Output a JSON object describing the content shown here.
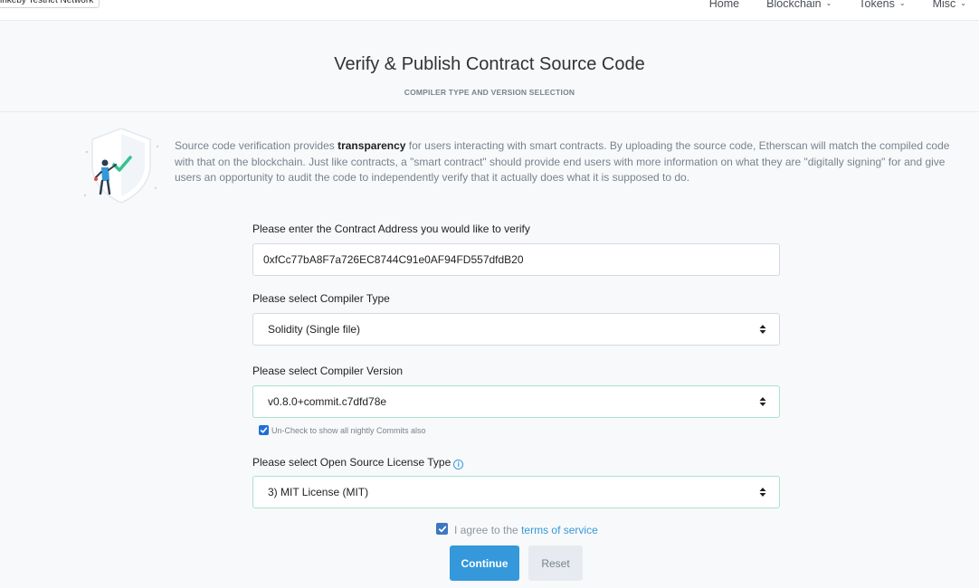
{
  "network_badge": "inkeby Testnet Network",
  "nav": {
    "home": "Home",
    "blockchain": "Blockchain",
    "tokens": "Tokens",
    "misc": "Misc"
  },
  "header": {
    "title": "Verify & Publish Contract Source Code",
    "subtitle": "COMPILER TYPE AND VERSION SELECTION"
  },
  "intro": {
    "part1": "Source code verification provides ",
    "bold": "transparency",
    "part2": " for users interacting with smart contracts. By uploading the source code, Etherscan will match the compiled code with that on the blockchain. Just like contracts, a \"smart contract\" should provide end users with more information on what they are \"digitally signing\" for and give users an opportunity to audit the code to independently verify that it actually does what it is supposed to do."
  },
  "form": {
    "address_label": "Please enter the Contract Address you would like to verify",
    "address_value": "0xfCc77bA8F7a726EC8744C91e0AF94FD557dfdB20",
    "compiler_type_label": "Please select Compiler Type",
    "compiler_type_value": "Solidity (Single file)",
    "compiler_version_label": "Please select Compiler Version",
    "compiler_version_value": "v0.8.0+commit.c7dfd78e",
    "nightly_note": "Un-Check to show all nightly Commits also",
    "nightly_checked": true,
    "license_label": "Please select Open Source License Type",
    "license_value": "3) MIT License (MIT)",
    "agree_prefix": "I agree to the ",
    "agree_link": "terms of service",
    "agree_checked": true,
    "continue_label": "Continue",
    "reset_label": "Reset"
  },
  "colors": {
    "accent": "#3498db",
    "focus_border": "#a9e2d0",
    "checkbox": "#1e6fd9",
    "muted_text": "#77838f"
  }
}
